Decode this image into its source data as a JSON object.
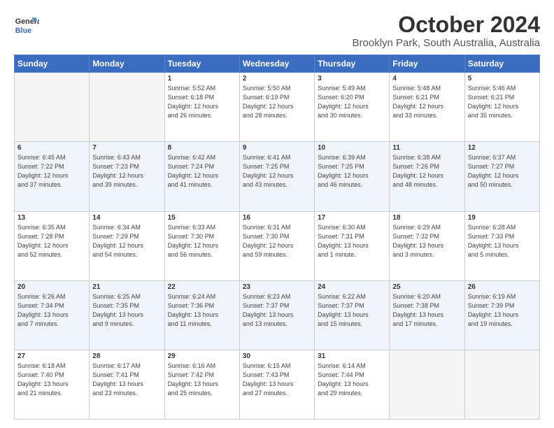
{
  "header": {
    "logo_line1": "General",
    "logo_line2": "Blue",
    "month": "October 2024",
    "location": "Brooklyn Park, South Australia, Australia"
  },
  "weekdays": [
    "Sunday",
    "Monday",
    "Tuesday",
    "Wednesday",
    "Thursday",
    "Friday",
    "Saturday"
  ],
  "weeks": [
    [
      {
        "day": "",
        "info": ""
      },
      {
        "day": "",
        "info": ""
      },
      {
        "day": "1",
        "info": "Sunrise: 5:52 AM\nSunset: 6:18 PM\nDaylight: 12 hours\nand 26 minutes."
      },
      {
        "day": "2",
        "info": "Sunrise: 5:50 AM\nSunset: 6:19 PM\nDaylight: 12 hours\nand 28 minutes."
      },
      {
        "day": "3",
        "info": "Sunrise: 5:49 AM\nSunset: 6:20 PM\nDaylight: 12 hours\nand 30 minutes."
      },
      {
        "day": "4",
        "info": "Sunrise: 5:48 AM\nSunset: 6:21 PM\nDaylight: 12 hours\nand 33 minutes."
      },
      {
        "day": "5",
        "info": "Sunrise: 5:46 AM\nSunset: 6:21 PM\nDaylight: 12 hours\nand 35 minutes."
      }
    ],
    [
      {
        "day": "6",
        "info": "Sunrise: 6:45 AM\nSunset: 7:22 PM\nDaylight: 12 hours\nand 37 minutes."
      },
      {
        "day": "7",
        "info": "Sunrise: 6:43 AM\nSunset: 7:23 PM\nDaylight: 12 hours\nand 39 minutes."
      },
      {
        "day": "8",
        "info": "Sunrise: 6:42 AM\nSunset: 7:24 PM\nDaylight: 12 hours\nand 41 minutes."
      },
      {
        "day": "9",
        "info": "Sunrise: 6:41 AM\nSunset: 7:25 PM\nDaylight: 12 hours\nand 43 minutes."
      },
      {
        "day": "10",
        "info": "Sunrise: 6:39 AM\nSunset: 7:25 PM\nDaylight: 12 hours\nand 46 minutes."
      },
      {
        "day": "11",
        "info": "Sunrise: 6:38 AM\nSunset: 7:26 PM\nDaylight: 12 hours\nand 48 minutes."
      },
      {
        "day": "12",
        "info": "Sunrise: 6:37 AM\nSunset: 7:27 PM\nDaylight: 12 hours\nand 50 minutes."
      }
    ],
    [
      {
        "day": "13",
        "info": "Sunrise: 6:35 AM\nSunset: 7:28 PM\nDaylight: 12 hours\nand 52 minutes."
      },
      {
        "day": "14",
        "info": "Sunrise: 6:34 AM\nSunset: 7:29 PM\nDaylight: 12 hours\nand 54 minutes."
      },
      {
        "day": "15",
        "info": "Sunrise: 6:33 AM\nSunset: 7:30 PM\nDaylight: 12 hours\nand 56 minutes."
      },
      {
        "day": "16",
        "info": "Sunrise: 6:31 AM\nSunset: 7:30 PM\nDaylight: 12 hours\nand 59 minutes."
      },
      {
        "day": "17",
        "info": "Sunrise: 6:30 AM\nSunset: 7:31 PM\nDaylight: 13 hours\nand 1 minute."
      },
      {
        "day": "18",
        "info": "Sunrise: 6:29 AM\nSunset: 7:32 PM\nDaylight: 13 hours\nand 3 minutes."
      },
      {
        "day": "19",
        "info": "Sunrise: 6:28 AM\nSunset: 7:33 PM\nDaylight: 13 hours\nand 5 minutes."
      }
    ],
    [
      {
        "day": "20",
        "info": "Sunrise: 6:26 AM\nSunset: 7:34 PM\nDaylight: 13 hours\nand 7 minutes."
      },
      {
        "day": "21",
        "info": "Sunrise: 6:25 AM\nSunset: 7:35 PM\nDaylight: 13 hours\nand 9 minutes."
      },
      {
        "day": "22",
        "info": "Sunrise: 6:24 AM\nSunset: 7:36 PM\nDaylight: 13 hours\nand 11 minutes."
      },
      {
        "day": "23",
        "info": "Sunrise: 6:23 AM\nSunset: 7:37 PM\nDaylight: 13 hours\nand 13 minutes."
      },
      {
        "day": "24",
        "info": "Sunrise: 6:22 AM\nSunset: 7:37 PM\nDaylight: 13 hours\nand 15 minutes."
      },
      {
        "day": "25",
        "info": "Sunrise: 6:20 AM\nSunset: 7:38 PM\nDaylight: 13 hours\nand 17 minutes."
      },
      {
        "day": "26",
        "info": "Sunrise: 6:19 AM\nSunset: 7:39 PM\nDaylight: 13 hours\nand 19 minutes."
      }
    ],
    [
      {
        "day": "27",
        "info": "Sunrise: 6:18 AM\nSunset: 7:40 PM\nDaylight: 13 hours\nand 21 minutes."
      },
      {
        "day": "28",
        "info": "Sunrise: 6:17 AM\nSunset: 7:41 PM\nDaylight: 13 hours\nand 23 minutes."
      },
      {
        "day": "29",
        "info": "Sunrise: 6:16 AM\nSunset: 7:42 PM\nDaylight: 13 hours\nand 25 minutes."
      },
      {
        "day": "30",
        "info": "Sunrise: 6:15 AM\nSunset: 7:43 PM\nDaylight: 13 hours\nand 27 minutes."
      },
      {
        "day": "31",
        "info": "Sunrise: 6:14 AM\nSunset: 7:44 PM\nDaylight: 13 hours\nand 29 minutes."
      },
      {
        "day": "",
        "info": ""
      },
      {
        "day": "",
        "info": ""
      }
    ]
  ]
}
